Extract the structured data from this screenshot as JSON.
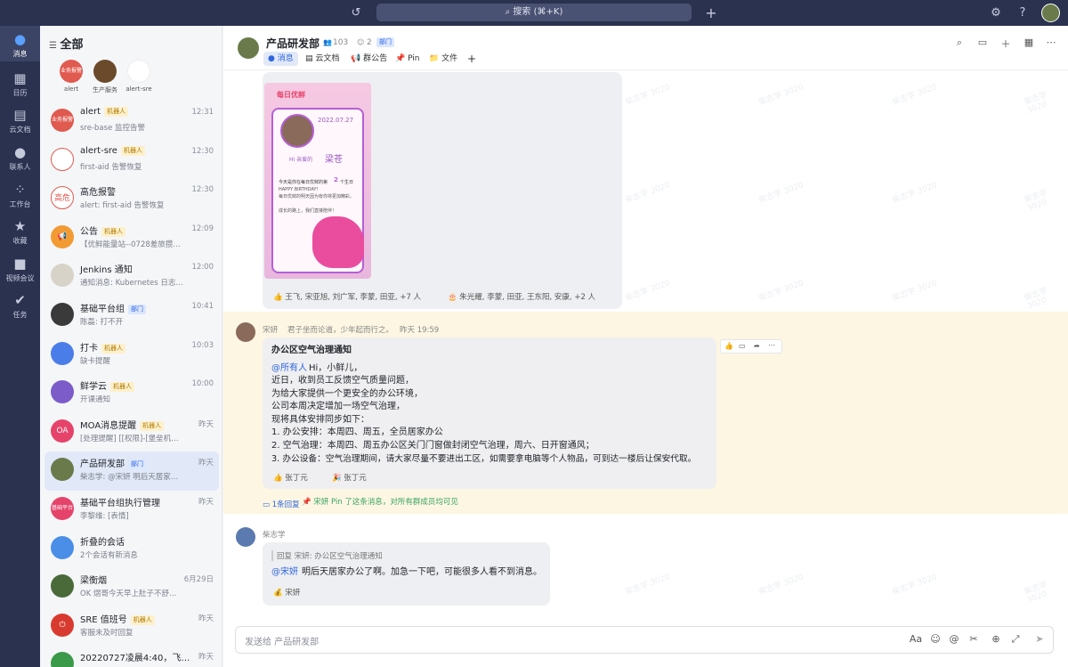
{
  "topbar": {
    "search_placeholder": "搜索 (⌘+K)"
  },
  "nav": [
    {
      "label": "消息",
      "icon": "chat-bubble-icon"
    },
    {
      "label": "日历",
      "icon": "calendar-icon"
    },
    {
      "label": "云文档",
      "icon": "doc-icon"
    },
    {
      "label": "联系人",
      "icon": "contacts-icon"
    },
    {
      "label": "工作台",
      "icon": "apps-icon"
    },
    {
      "label": "收藏",
      "icon": "star-icon"
    },
    {
      "label": "视频会议",
      "icon": "video-icon"
    },
    {
      "label": "任务",
      "icon": "check-icon"
    }
  ],
  "conv_list": {
    "title": "全部",
    "pinned": [
      {
        "label": "alert",
        "avatar_text": "业务报警",
        "color": "#e05a4f"
      },
      {
        "label": "生产服务",
        "avatar_text": "",
        "color": "#6b4a2c"
      },
      {
        "label": "alert-sre",
        "avatar_text": "",
        "color": "#ffffff"
      }
    ],
    "items": [
      {
        "name": "alert",
        "tag": "机器人",
        "sub": "sre-base 监控告警",
        "time": "12:31",
        "avatar_text": "业务报警",
        "color": "#e05a4f"
      },
      {
        "name": "alert-sre",
        "tag": "机器人",
        "sub": "first-aid 告警恢复",
        "time": "12:30",
        "avatar_text": "",
        "color": "#ffffff"
      },
      {
        "name": "高危报警",
        "tag": "",
        "sub": "alert: first-aid 告警恢复",
        "time": "12:30",
        "avatar_text": "高危",
        "color": "#ffffff"
      },
      {
        "name": "公告",
        "tag": "机器人",
        "sub": "【优鲜能量站--0728差旅攒…",
        "time": "12:09",
        "avatar_text": "📢",
        "color": "#f39b33"
      },
      {
        "name": "Jenkins 通知",
        "tag": "",
        "sub": "通知消息: Kubernetes 日志…",
        "time": "12:00",
        "avatar_text": "",
        "color": "#d8d3c8"
      },
      {
        "name": "基础平台组",
        "tag": "部门",
        "sub": "陈磊: 打不开",
        "time": "10:41",
        "avatar_text": "",
        "color": "#3a3a3a"
      },
      {
        "name": "打卡",
        "tag": "机器人",
        "sub": "缺卡提醒",
        "time": "10:03",
        "avatar_text": "",
        "color": "#4a7de8"
      },
      {
        "name": "鲜学云",
        "tag": "机器人",
        "sub": "开课通知",
        "time": "10:00",
        "avatar_text": "",
        "color": "#7b5cc9"
      },
      {
        "name": "MOA消息提醒",
        "tag": "机器人",
        "sub": "[处理提醒] [[权限]-[堡垒机…",
        "time": "昨天",
        "avatar_text": "OA",
        "color": "#e6436a"
      },
      {
        "name": "产品研发部",
        "tag": "部门",
        "sub": "柴志学: @宋妍 明后天居家…",
        "time": "昨天",
        "avatar_text": "",
        "color": "#6a7a4a"
      },
      {
        "name": "基础平台组执行管理",
        "tag": "",
        "sub": "李黎维: [表情]",
        "time": "昨天",
        "avatar_text": "基础平台",
        "color": "#e6436a"
      },
      {
        "name": "折叠的会话",
        "tag": "",
        "sub": "2个会话有新消息",
        "time": "",
        "avatar_text": "",
        "color": "#4a8ee8"
      },
      {
        "name": "梁衡烟",
        "tag": "",
        "sub": "OK 熠哥今天早上肚子不舒…",
        "time": "6月29日",
        "avatar_text": "",
        "color": "#4a6a3a"
      },
      {
        "name": "SRE 值班号",
        "tag": "机器人",
        "sub": "客服未及时回复",
        "time": "昨天",
        "avatar_text": "⏻",
        "color": "#d93a2f"
      },
      {
        "name": "20220727凌晨4:40，飞…",
        "tag": "",
        "sub": "",
        "time": "昨天",
        "avatar_text": "",
        "color": "#3a9a4a"
      }
    ]
  },
  "chat": {
    "title": "产品研发部",
    "members": "103",
    "bots": "2",
    "dept_tag": "部门",
    "tabs": [
      "消息",
      "云文档",
      "群公告",
      "Pin",
      "文件",
      "+"
    ],
    "card": {
      "brand": "每日优鲜",
      "date": "2022.07.27",
      "greet": "Hi 亲爱的",
      "name": "梁苍",
      "line1": "今天是你在每日优鲜的第",
      "years": "2",
      "line1b": "个生日",
      "line2": "HAPPY BIRTHDAY!",
      "line3": "每日优鲜的明天因为有你将更加精彩。",
      "line4": "成长的路上，我们直接陪伴！"
    },
    "card_reactions": [
      {
        "names": "王飞, 宋亚旭, 刘广军, 李蒙, 田亚, +7 人"
      },
      {
        "names": "朱光耀, 李蒙, 田亚, 王东阳, 安康, +2 人"
      }
    ],
    "msg2": {
      "sender": "宋妍",
      "signature": "君子坐而论道，少年起而行之。",
      "time": "昨天 19:59",
      "title": "办公区空气治理通知",
      "mention": "@所有人",
      "lines": [
        "Hi，小鲜儿，",
        "近日，收到员工反馈空气质量问题，",
        "为给大家提供一个更安全的办公环境，",
        "公司本周决定增加一场空气治理，",
        "现将具体安排同步如下：",
        "1. 办公安排：本周四、周五，全员居家办公",
        "2. 空气治理：本周四、周五办公区关门门窗做封闭空气治理，周六、日开窗通风；",
        "3. 办公设备：空气治理期间，请大家尽量不要进出工区，如需要拿电脑等个人物品，可到达一楼后让保安代取。"
      ],
      "reactions": [
        "张丁元",
        "张丁元"
      ],
      "reply_count": "1条回复",
      "pin_note": "宋妍 Pin 了这条消息，对所有群成员均可见"
    },
    "msg3": {
      "sender": "柴志学",
      "quote": "回复 宋妍: 办公区空气治理通知",
      "mention": "@宋妍",
      "text": "明后天居家办公了啊。加急一下吧，可能很多人看不到消息。",
      "reaction": "宋妍"
    },
    "input_placeholder": "发送给 产品研发部",
    "watermark": "柴志学 3020"
  }
}
